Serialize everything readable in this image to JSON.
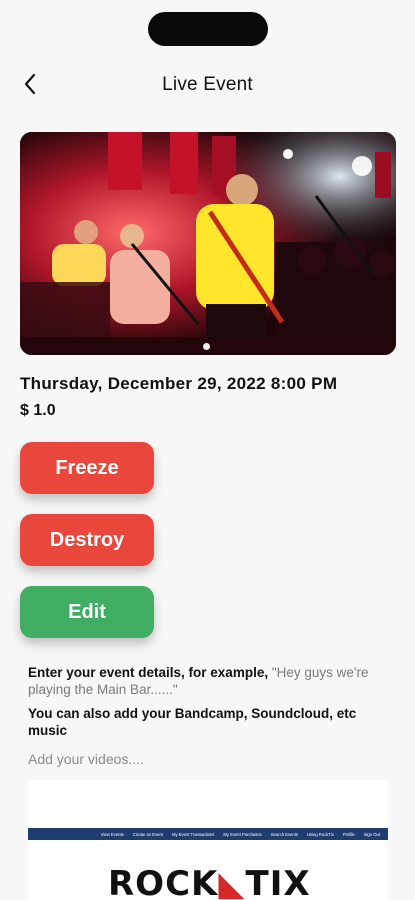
{
  "nav": {
    "title": "Live Event",
    "back_icon": "chevron-left-icon"
  },
  "event": {
    "date": "Thursday, December 29, 2022 8:00 PM",
    "price": "$ 1.0",
    "image_description": "band performing on stage under red lights"
  },
  "actions": {
    "freeze_label": "Freeze",
    "destroy_label": "Destroy",
    "edit_label": "Edit"
  },
  "description": {
    "prompt": "Enter your event details, for example, ",
    "example": "\"Hey guys we're playing the Main Bar......\"",
    "addon": "You can also add your Bandcamp, Soundcloud, etc music"
  },
  "videos": {
    "placeholder": "Add your videos...."
  },
  "embed": {
    "nav_items": [
      "View Events",
      "Create an Event",
      "My Event Transactions",
      "My Event Purchases",
      "Search Events",
      "Using RockTix",
      "Profile",
      "Sign Out"
    ],
    "logo_left": "ROCK",
    "logo_right": "TIX"
  },
  "colors": {
    "destructive": "#e9473c",
    "success": "#3fae62",
    "embed_nav": "#1f3d6e"
  }
}
